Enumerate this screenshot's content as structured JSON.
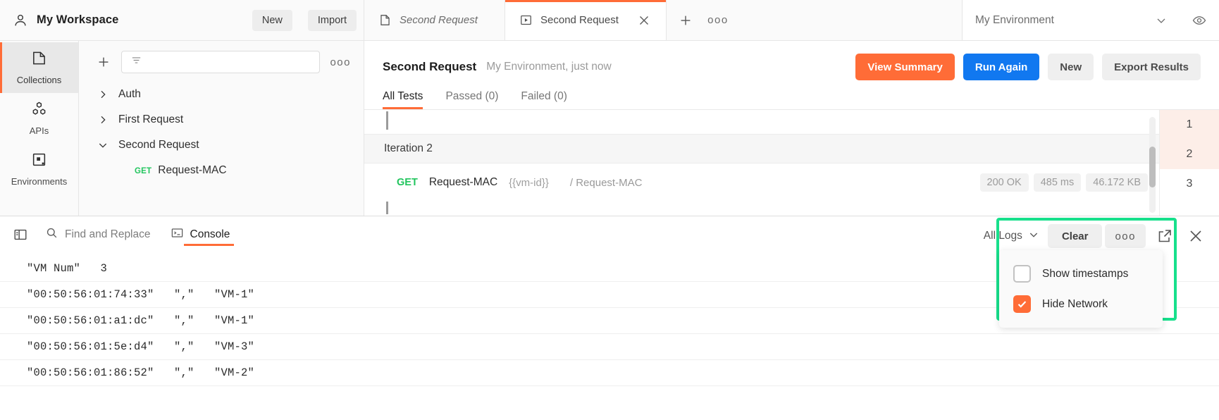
{
  "topbar": {
    "workspace_title": "My Workspace",
    "new_label": "New",
    "import_label": "Import",
    "tabs": [
      {
        "label": "Second Request",
        "icon": "document-icon",
        "active": false
      },
      {
        "label": "Second Request",
        "icon": "runner-play-icon",
        "active": true
      }
    ],
    "add_tab_icon": "plus-icon",
    "tab_more_icon": "more-horizontal-icon",
    "environment": "My Environment",
    "env_chevron_icon": "chevron-down-icon",
    "env_eye_icon": "eye-icon"
  },
  "rail": {
    "items": [
      {
        "label": "Collections",
        "icon": "collections-icon",
        "active": true
      },
      {
        "label": "APIs",
        "icon": "apis-icon",
        "active": false
      },
      {
        "label": "Environments",
        "icon": "environments-icon",
        "active": false
      }
    ]
  },
  "sidebar": {
    "add_icon": "plus-icon",
    "filter_icon": "filter-icon",
    "filter_placeholder": "",
    "more_icon": "more-horizontal-icon",
    "tree": [
      {
        "label": "Auth",
        "expanded": false,
        "chevron": "chevron-right-icon"
      },
      {
        "label": "First Request",
        "expanded": false,
        "chevron": "chevron-right-icon"
      },
      {
        "label": "Second Request",
        "expanded": true,
        "chevron": "chevron-down-icon"
      }
    ],
    "child": {
      "method": "GET",
      "label": "Request-MAC"
    }
  },
  "runner": {
    "title": "Second Request",
    "subtitle": "My Environment, just now",
    "buttons": {
      "view_summary": "View Summary",
      "run_again": "Run Again",
      "new": "New",
      "export_results": "Export Results"
    },
    "tabs": [
      {
        "label": "All Tests",
        "active": true
      },
      {
        "label": "Passed (0)",
        "active": false
      },
      {
        "label": "Failed (0)",
        "active": false
      }
    ],
    "iteration_heading": "Iteration 2",
    "request": {
      "method": "GET",
      "name": "Request-MAC",
      "variable": "{{vm-id}}",
      "path": "/ Request-MAC",
      "status": "200 OK",
      "time": "485 ms",
      "size": "46.172 KB"
    },
    "iteration_numbers": [
      {
        "n": "1",
        "highlight": true
      },
      {
        "n": "2",
        "highlight": true
      },
      {
        "n": "3",
        "highlight": false
      }
    ]
  },
  "console": {
    "layout_icon": "layout-sidebar-icon",
    "find_replace": {
      "label": "Find and Replace",
      "icon": "search-icon"
    },
    "console_tab": {
      "label": "Console",
      "icon": "terminal-icon",
      "active": true
    },
    "filter_label": "All Logs",
    "filter_chevron_icon": "chevron-down-icon",
    "clear_label": "Clear",
    "more_icon": "more-horizontal-icon",
    "popout_icon": "external-link-icon",
    "close_icon": "close-icon",
    "menu": [
      {
        "label": "Show timestamps",
        "checked": false
      },
      {
        "label": "Hide Network",
        "checked": true
      }
    ],
    "logs": [
      "\"VM Num\"   3",
      "\"00:50:56:01:74:33\"   \",\"   \"VM-1\"",
      "\"00:50:56:01:a1:dc\"   \",\"   \"VM-1\"",
      "\"00:50:56:01:5e:d4\"   \",\"   \"VM-3\"",
      "\"00:50:56:01:86:52\"   \",\"   \"VM-2\""
    ]
  },
  "colors": {
    "accent_orange": "#ff6c37",
    "primary_blue": "#1178f0",
    "method_green": "#22c55e",
    "highlight_green": "#17e08c",
    "iteration_highlight": "#fdeee8"
  }
}
